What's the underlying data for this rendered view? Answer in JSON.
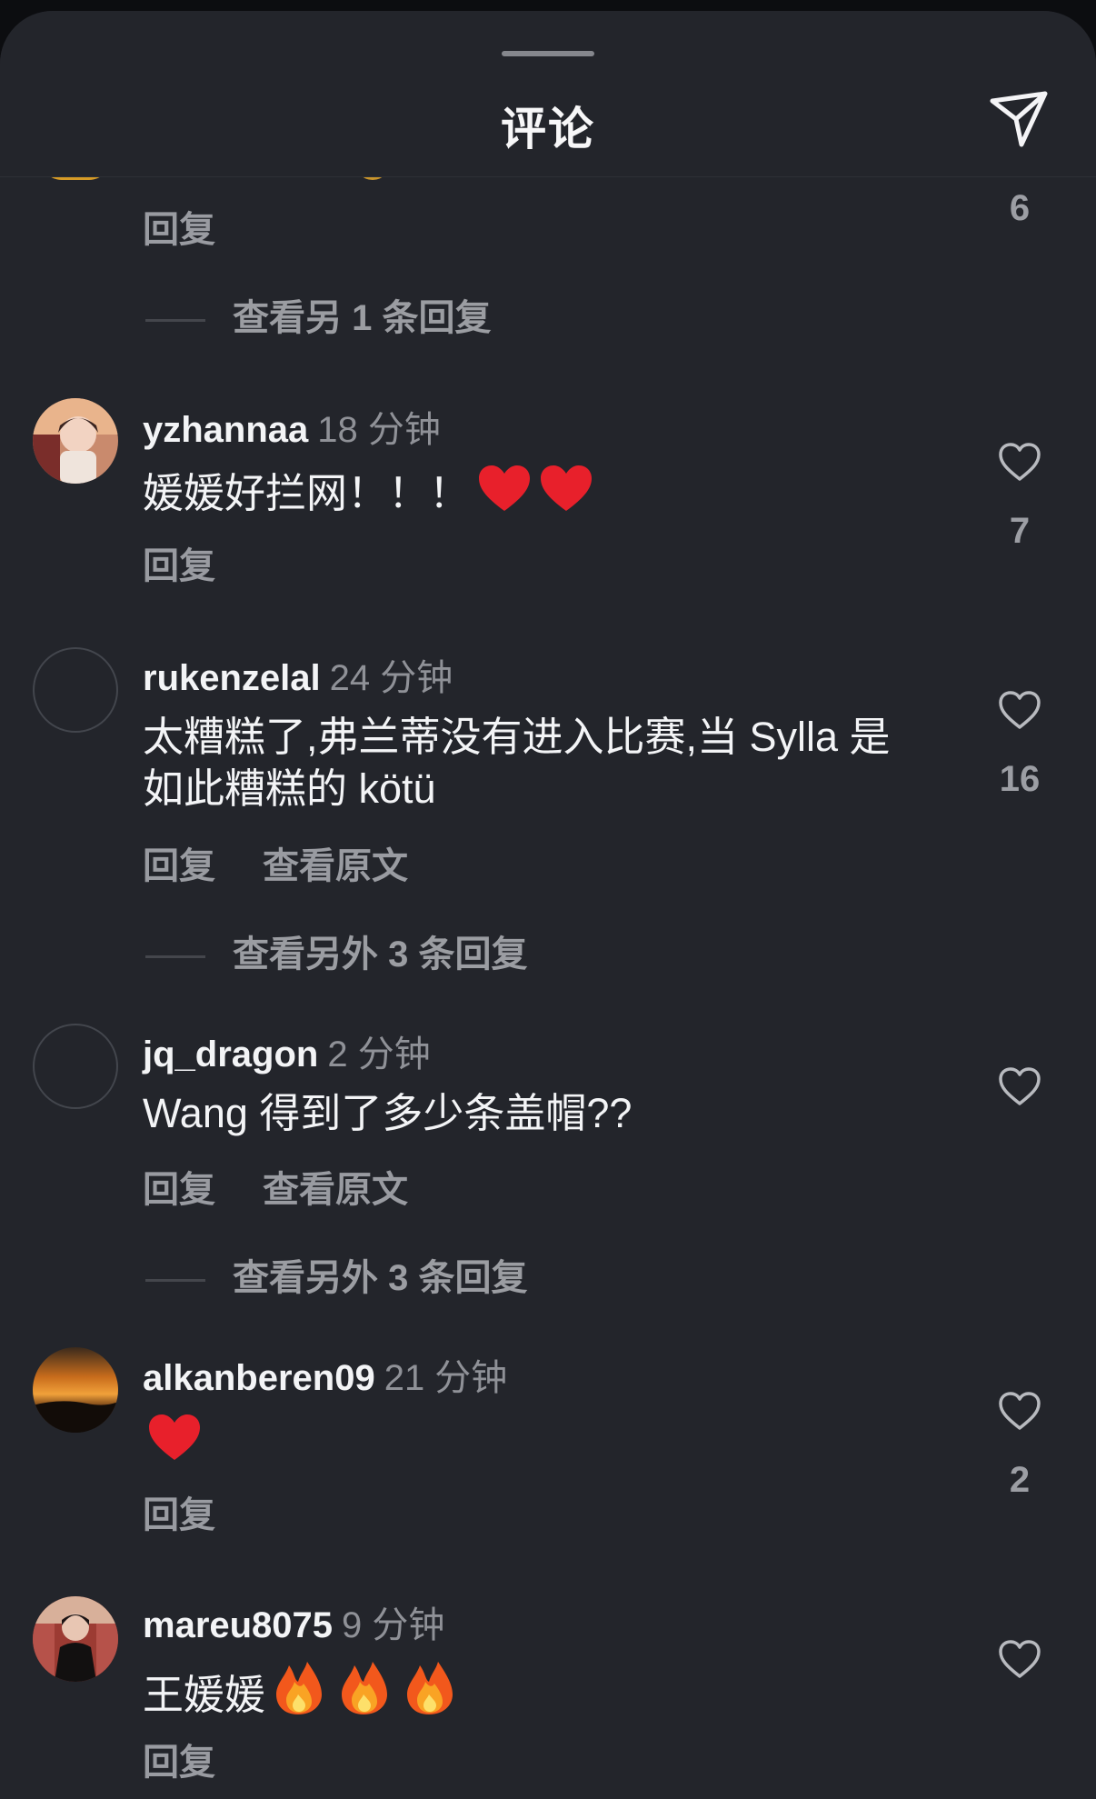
{
  "header": {
    "title": "评论",
    "share_icon": "send-icon"
  },
  "partial_top": {
    "reply_label": "回复",
    "like_count": "6",
    "more_replies": "查看另 1 条回复"
  },
  "comments": [
    {
      "username": "yzhannaa",
      "time": "18 分钟",
      "text": "媛媛好拦网！！！",
      "emoji": "❤️❤️",
      "actions": [
        "回复"
      ],
      "like_count": "7"
    },
    {
      "username": "rukenzelal",
      "time": "24 分钟",
      "text_line1": "太糟糕了,弗兰蒂没有进入比赛,当 Sylla 是",
      "text_line2": "如此糟糕的 kötü",
      "actions": [
        "回复",
        "查看原文"
      ],
      "like_count": "16",
      "more_replies": "查看另外 3 条回复"
    },
    {
      "username": "jq_dragon",
      "time": "2 分钟",
      "text": "Wang 得到了多少条盖帽??",
      "actions": [
        "回复",
        "查看原文"
      ],
      "like_count": "",
      "more_replies": "查看另外 3 条回复"
    },
    {
      "username": "alkanberen09",
      "time": "21 分钟",
      "text": "",
      "emoji": "❤️",
      "actions": [
        "回复"
      ],
      "like_count": "2"
    },
    {
      "username": "mareu8075",
      "time": "9 分钟",
      "text": "王媛媛",
      "emoji": "🔥🔥🔥",
      "actions": [
        "回复"
      ],
      "like_count": ""
    }
  ],
  "colors": {
    "sheet_background": "#23252b",
    "secondary_text": "#999ba1",
    "primary_text": "#f3f4f6"
  }
}
